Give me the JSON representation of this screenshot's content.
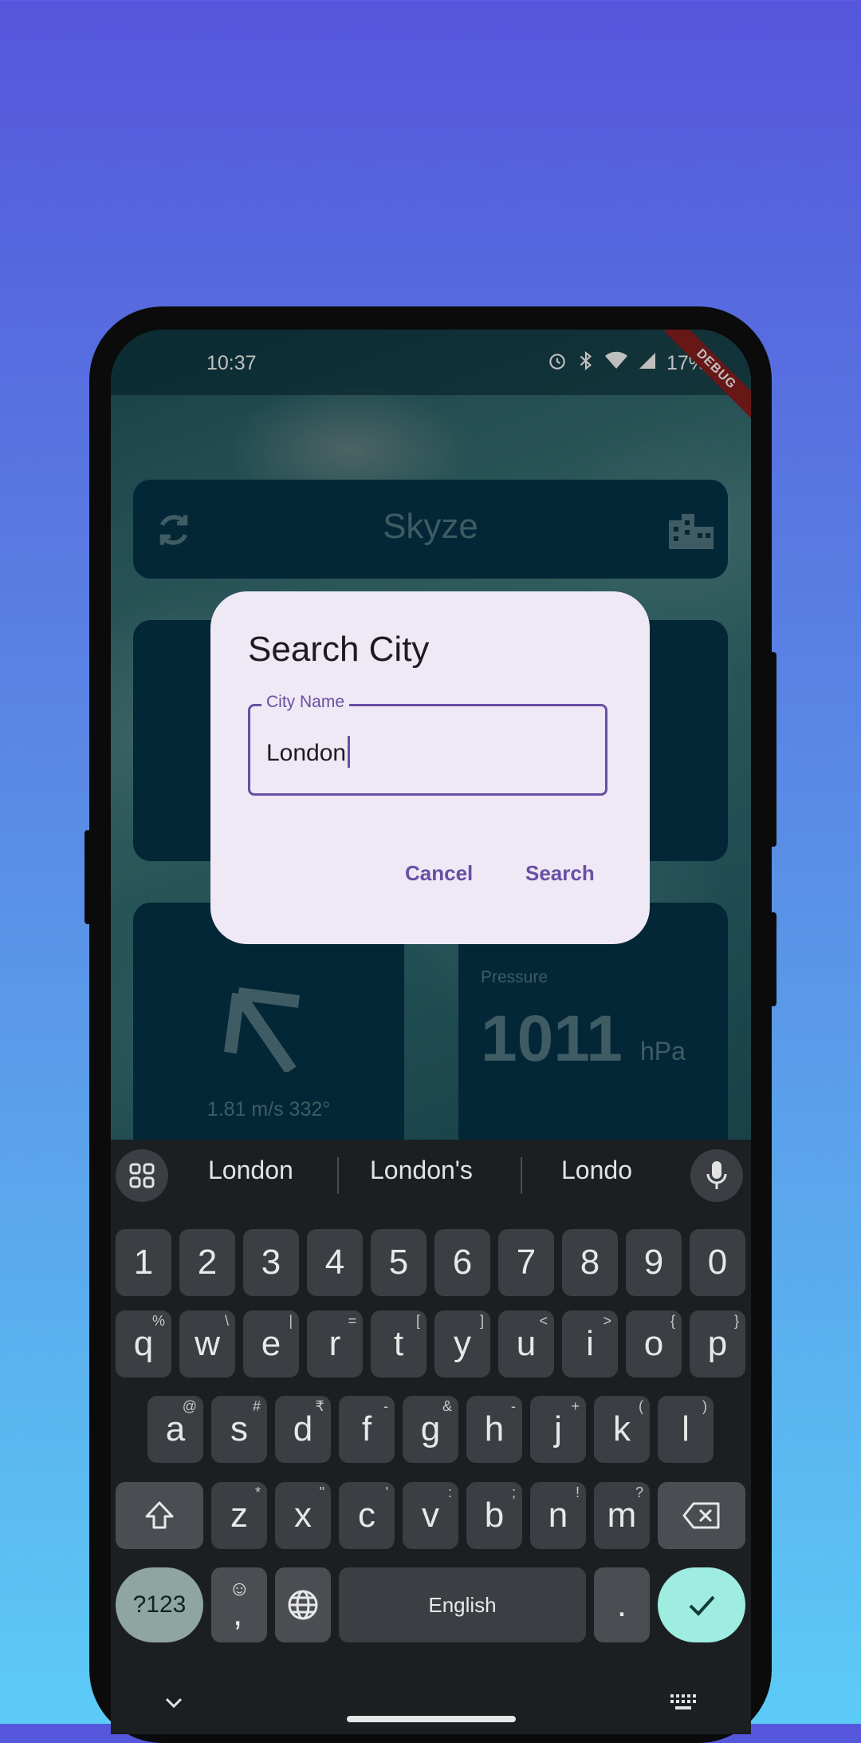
{
  "status": {
    "time": "10:37",
    "battery": "17%",
    "debug": "DEBUG"
  },
  "app": {
    "title": "Skyze",
    "wind": {
      "text": "1.81 m/s 332°"
    },
    "pressure": {
      "label": "Pressure",
      "value": "1011",
      "unit": "hPa"
    }
  },
  "dialog": {
    "title": "Search City",
    "field_label": "City Name",
    "field_value": "London",
    "cancel": "Cancel",
    "search": "Search"
  },
  "keyboard": {
    "suggestions": [
      "London",
      "London's",
      "Londo"
    ],
    "row_numbers": [
      "1",
      "2",
      "3",
      "4",
      "5",
      "6",
      "7",
      "8",
      "9",
      "0"
    ],
    "row1": [
      {
        "k": "q",
        "h": "%"
      },
      {
        "k": "w",
        "h": "\\"
      },
      {
        "k": "e",
        "h": "|"
      },
      {
        "k": "r",
        "h": "="
      },
      {
        "k": "t",
        "h": "["
      },
      {
        "k": "y",
        "h": "]"
      },
      {
        "k": "u",
        "h": "<"
      },
      {
        "k": "i",
        "h": ">"
      },
      {
        "k": "o",
        "h": "{"
      },
      {
        "k": "p",
        "h": "}"
      }
    ],
    "row2": [
      {
        "k": "a",
        "h": "@"
      },
      {
        "k": "s",
        "h": "#"
      },
      {
        "k": "d",
        "h": "₹"
      },
      {
        "k": "f",
        "h": "-"
      },
      {
        "k": "g",
        "h": "&"
      },
      {
        "k": "h",
        "h": "-"
      },
      {
        "k": "j",
        "h": "+"
      },
      {
        "k": "k",
        "h": "("
      },
      {
        "k": "l",
        "h": ")"
      }
    ],
    "row3": [
      {
        "k": "z",
        "h": "*"
      },
      {
        "k": "x",
        "h": "\""
      },
      {
        "k": "c",
        "h": "'"
      },
      {
        "k": "v",
        "h": ":"
      },
      {
        "k": "b",
        "h": ";"
      },
      {
        "k": "n",
        "h": "!"
      },
      {
        "k": "m",
        "h": "?"
      }
    ],
    "symbols_key": "?123",
    "comma_key": ",",
    "space_key": "English",
    "period_key": "."
  }
}
